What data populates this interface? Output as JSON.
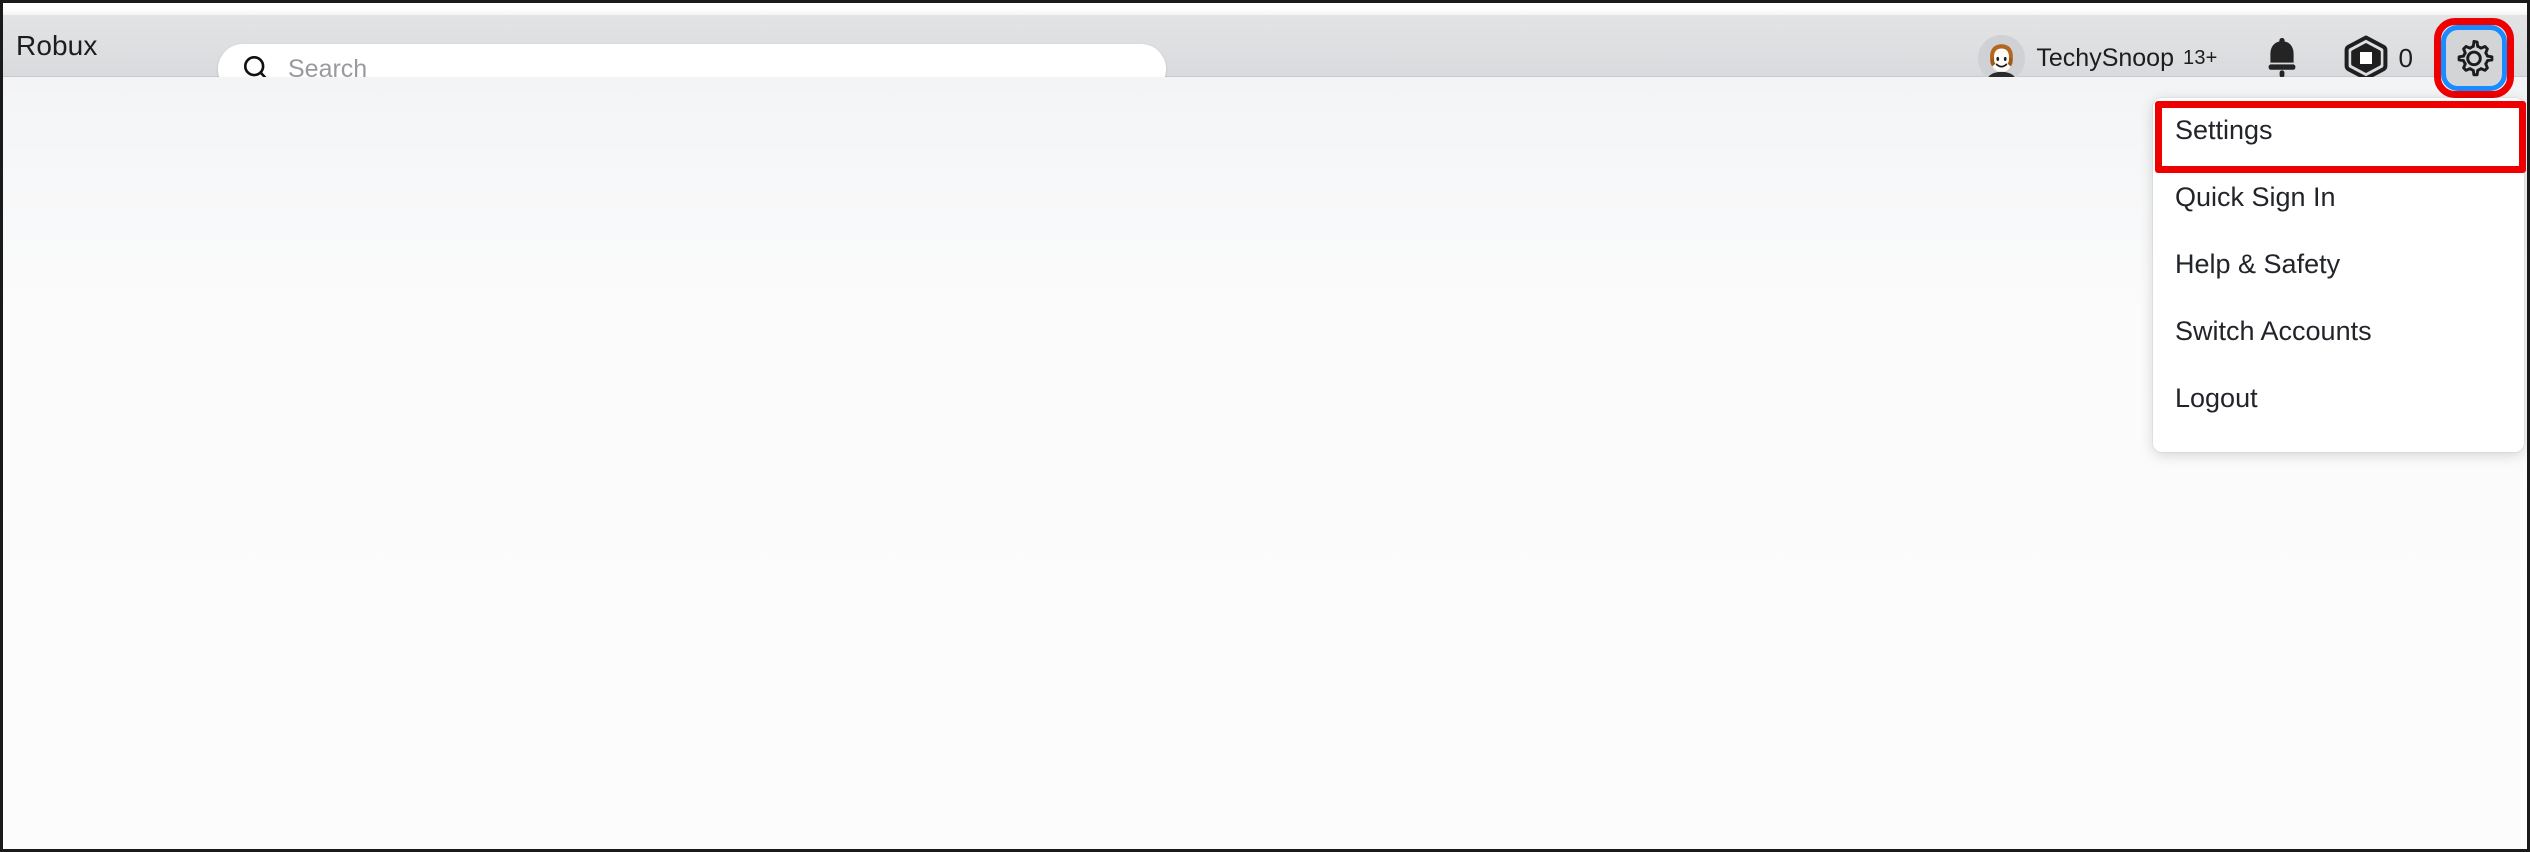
{
  "window": {
    "background_color": "#fbfbfb",
    "border_color": "#1a1a1a"
  },
  "header": {
    "brand": "Robux",
    "background_color": "#dedfe1",
    "search": {
      "placeholder": "Search",
      "value": "",
      "icon": "search-icon"
    },
    "account": {
      "avatar_icon": "roblox-avatar-icon",
      "username": "TechySnoop",
      "age_badge": "13+"
    },
    "notifications": {
      "icon": "bell-icon",
      "label": "Notifications"
    },
    "robux": {
      "icon": "robux-hexagon-icon",
      "amount": "0",
      "label": "Robux"
    },
    "settings_button": {
      "icon": "gear-icon",
      "label": "Settings",
      "highlight_outer_color": "#ef0000",
      "highlight_inner_color": "#1a8cff",
      "button_background": "#d3d4d6"
    }
  },
  "dropdown": {
    "visible": true,
    "background_color": "#ffffff",
    "highlight_color": "#ef0000",
    "items": [
      {
        "label": "Settings",
        "name": "settings",
        "highlighted": true
      },
      {
        "label": "Quick Sign In",
        "name": "quick-sign-in",
        "highlighted": false
      },
      {
        "label": "Help & Safety",
        "name": "help-and-safety",
        "highlighted": false
      },
      {
        "label": "Switch Accounts",
        "name": "switch-accounts",
        "highlighted": false
      },
      {
        "label": "Logout",
        "name": "logout",
        "highlighted": false
      }
    ]
  },
  "page": {
    "content": ""
  }
}
